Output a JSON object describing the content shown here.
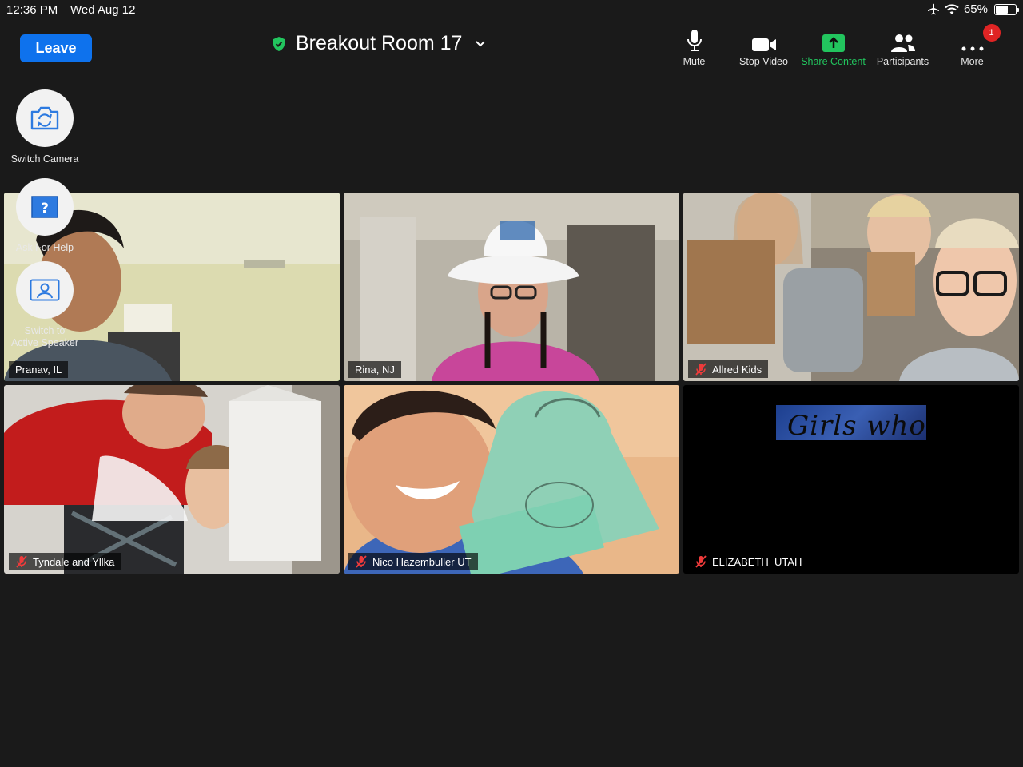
{
  "status": {
    "time": "12:36 PM",
    "date": "Wed Aug 12",
    "battery": "65%",
    "battery_level": 0.65
  },
  "toolbar": {
    "leave_label": "Leave",
    "room_title": "Breakout Room 17",
    "mute_label": "Mute",
    "stop_video_label": "Stop Video",
    "share_label": "Share Content",
    "participants_label": "Participants",
    "more_label": "More",
    "more_badge": "1"
  },
  "floating": {
    "switch_camera": "Switch Camera",
    "ask_help": "Ask For Help",
    "switch_speaker_line1": "Switch to",
    "switch_speaker_line2": "Active Speaker"
  },
  "tiles": [
    {
      "name": "Pranav, IL",
      "muted": false,
      "active": true
    },
    {
      "name": "Rina, NJ",
      "muted": false,
      "active": false
    },
    {
      "name": "Allred Kids",
      "muted": true,
      "active": false
    },
    {
      "name": "Tyndale and Yllka",
      "muted": true,
      "active": false
    },
    {
      "name": "Nico Hazembuller UT",
      "muted": true,
      "active": false
    },
    {
      "name": "ELIZABETH  UTAH",
      "muted": true,
      "active": false
    }
  ],
  "banner_text": "Girls who",
  "colors": {
    "leave": "#0e72ed",
    "share": "#22c55e",
    "active_border": "#2ecc40",
    "badge": "#e02424"
  }
}
